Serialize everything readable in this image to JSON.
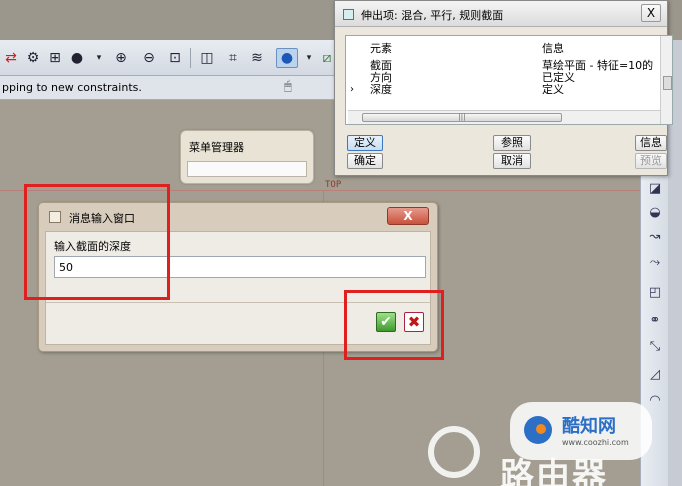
{
  "message_bar": {
    "text": "pping to new constraints."
  },
  "menu_manager": {
    "title": "菜单管理器"
  },
  "datum": {
    "label": "TOP"
  },
  "feature_dialog": {
    "title": "伸出项: 混合, 平行, 规则截面",
    "columns": [
      "元素",
      "信息"
    ],
    "rows": [
      {
        "element": "截面",
        "info": "草绘平面 - 特征=10的"
      },
      {
        "element": "方向",
        "info": "已定义"
      },
      {
        "element": "深度",
        "info": "定义"
      }
    ],
    "close_label": "X",
    "buttons": {
      "define": "定义",
      "reference": "参照",
      "info": "信息",
      "ok": "确定",
      "cancel": "取消",
      "preview": "预览"
    }
  },
  "input_dialog": {
    "title": "消息输入窗口",
    "prompt": "输入截面的深度",
    "value": "50",
    "close_label": "X",
    "ok_icon": "✔",
    "cancel_icon": "✖"
  },
  "watermark": {
    "brand": "酷知网",
    "url": "www.coozhi.com",
    "big_text": "路由器"
  },
  "colors": {
    "annotation": "#e0201f",
    "ok_green": "#3f9a2e",
    "cancel_red": "#c01818"
  }
}
